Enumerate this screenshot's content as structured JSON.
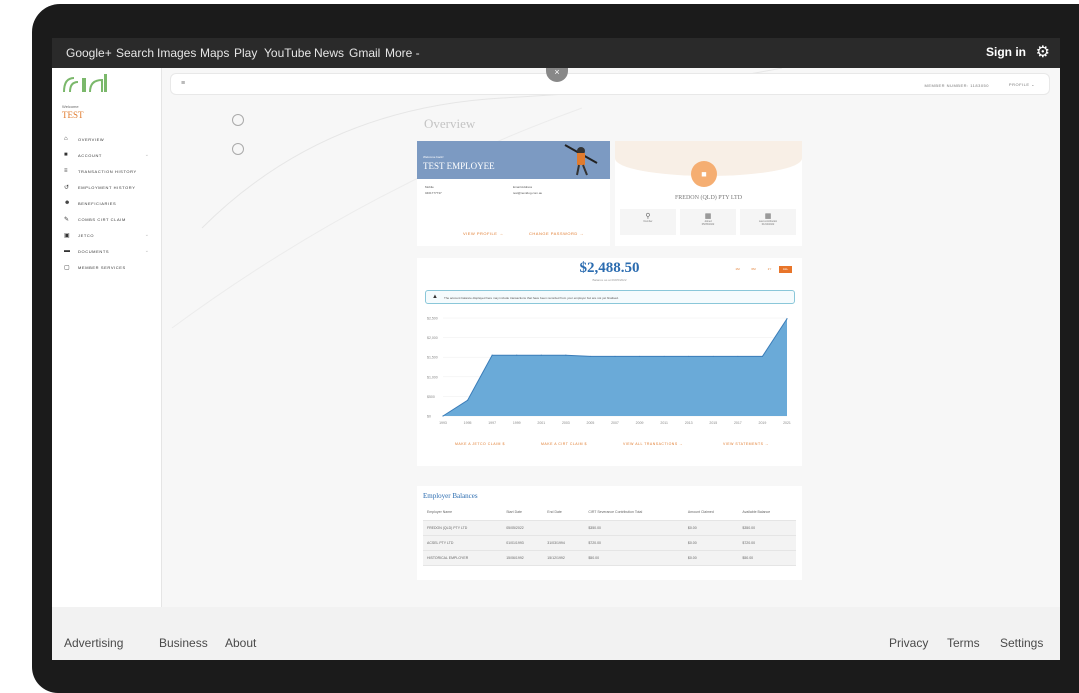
{
  "browser": {
    "nav_links": [
      "Google+",
      "Search",
      "Images",
      "Maps",
      "Play",
      "YouTube",
      "News",
      "Gmail",
      "More -"
    ],
    "sign_in": "Sign in"
  },
  "sidebar": {
    "welcome": "Welcome",
    "username": "TEST",
    "items": [
      {
        "label": "OVERVIEW",
        "icon": "home-icon"
      },
      {
        "label": "ACCOUNT",
        "icon": "account-icon"
      },
      {
        "label": "TRANSACTION HISTORY",
        "icon": "list-icon"
      },
      {
        "label": "EMPLOYMENT HISTORY",
        "icon": "history-icon"
      },
      {
        "label": "BENEFICIARIES",
        "icon": "people-icon"
      },
      {
        "label": "COMBS CIRT CLAIM",
        "icon": "claim-icon"
      },
      {
        "label": "JETCO",
        "icon": "briefcase-icon"
      },
      {
        "label": "DOCUMENTS",
        "icon": "folder-icon"
      },
      {
        "label": "MEMBER SERVICES",
        "icon": "services-icon"
      }
    ]
  },
  "header": {
    "member_number": "MEMBER NUMBER: 1183050",
    "profile": "PROFILE"
  },
  "overview": {
    "title": "Overview"
  },
  "employee": {
    "welcome": "Welcome back!",
    "name": "TEST EMPLOYEE",
    "mobile_label": "Mobile",
    "mobile_value": "0461777737",
    "email_label": "Email Address",
    "email_value": "test@nextdog.com.au",
    "view_profile": "VIEW PROFILE",
    "change_password": "CHANGE PASSWORD"
  },
  "company": {
    "name": "FREDON (QLD) PTY LTD",
    "stats": [
      {
        "label": "Number",
        "value": ""
      },
      {
        "label": "Joined",
        "value": "05/05/2022"
      },
      {
        "label": "Last contribution",
        "value": "01/04/2022"
      }
    ]
  },
  "balance": {
    "amount": "$2,488.50",
    "as_at": "Balance as at 09/05/2022",
    "tabs": [
      "1M",
      "6M",
      "1Y",
      "ALL"
    ],
    "active_tab": "ALL",
    "alert": "The account balance displayed here may include transactions that have been recorded from your employer but are not yet finalised."
  },
  "chart_data": {
    "type": "area",
    "x": [
      "1993",
      "1995",
      "1997",
      "1999",
      "2001",
      "2003",
      "2005",
      "2007",
      "2009",
      "2011",
      "2013",
      "2015",
      "2017",
      "2019",
      "2021"
    ],
    "y_ticks": [
      "$0",
      "$500",
      "$1,000",
      "$1,500",
      "$2,000",
      "$2,500"
    ],
    "series": [
      {
        "values": [
          0,
          400,
          1550,
          1550,
          1550,
          1550,
          1520,
          1520,
          1520,
          1520,
          1520,
          1520,
          1520,
          1520,
          2480
        ]
      }
    ],
    "ylim": [
      0,
      2500
    ],
    "color": "#6aaad8"
  },
  "actions": {
    "jetco": "MAKE A JETCO CLAIM",
    "cirt": "MAKE A CIRT CLAIM",
    "transactions": "VIEW ALL TRANSACTIONS",
    "statements": "VIEW STATEMENTS"
  },
  "employer_balances": {
    "title": "Employer Balances",
    "columns": [
      "Employer Name",
      "Start Date",
      "End Date",
      "CIRT Severance Contribution Total",
      "Amount Claimed",
      "Available Balance"
    ],
    "rows": [
      [
        "FREDON (QLD) PTY LTD",
        "05/05/2022",
        "",
        "$350.00",
        "$0.00",
        "$350.00"
      ],
      [
        "ACSEL PTY LTD",
        "01/01/1993",
        "31/03/1994",
        "$720.00",
        "$0.00",
        "$720.00"
      ],
      [
        "HISTORICAL EMPLOYER",
        "15/06/1992",
        "15/12/1992",
        "$50.00",
        "$0.00",
        "$50.00"
      ]
    ]
  },
  "footer": {
    "left": [
      "Advertising",
      "Business",
      "About"
    ],
    "right": [
      "Privacy",
      "Terms",
      "Settings"
    ]
  }
}
